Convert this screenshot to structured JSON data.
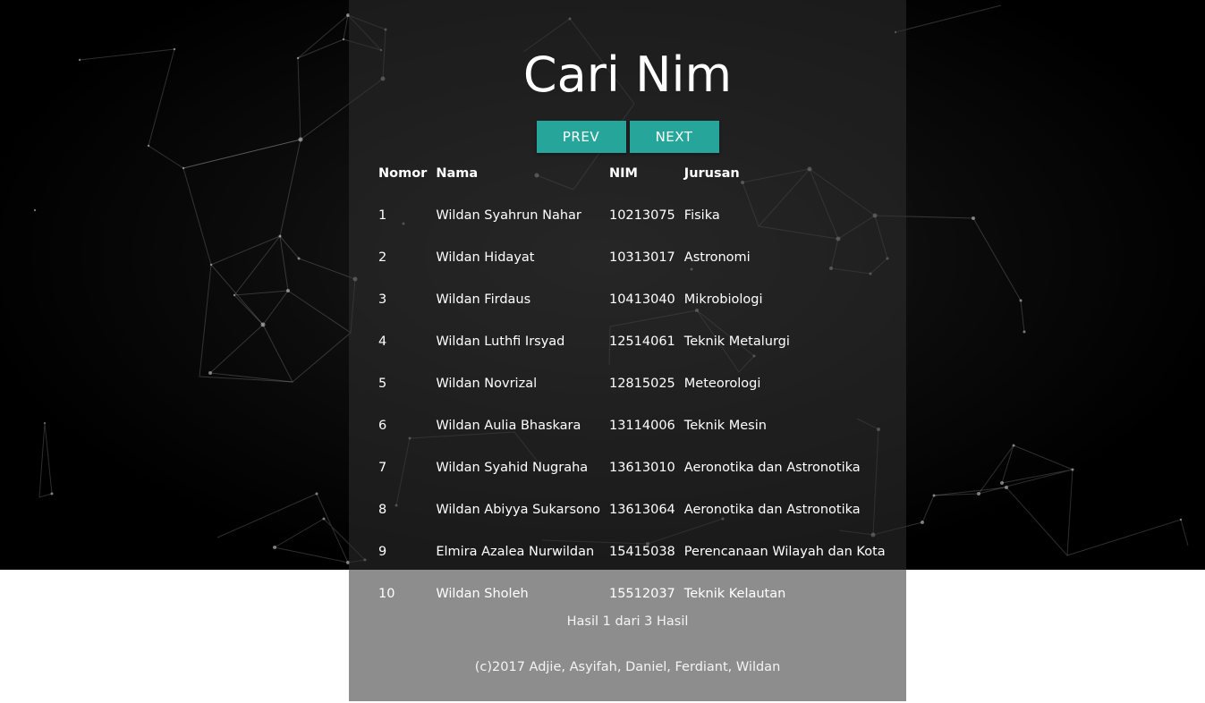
{
  "page": {
    "title": "Cari Nim"
  },
  "nav": {
    "prev_label": "PREV",
    "next_label": "NEXT"
  },
  "table": {
    "headers": [
      "Nomor",
      "Nama",
      "NIM",
      "Jurusan"
    ],
    "rows": [
      [
        "1",
        "Wildan Syahrun Nahar",
        "10213075",
        "Fisika"
      ],
      [
        "2",
        "Wildan Hidayat",
        "10313017",
        "Astronomi"
      ],
      [
        "3",
        "Wildan Firdaus",
        "10413040",
        "Mikrobiologi"
      ],
      [
        "4",
        "Wildan Luthfi Irsyad",
        "12514061",
        "Teknik Metalurgi"
      ],
      [
        "5",
        "Wildan Novrizal",
        "12815025",
        "Meteorologi"
      ],
      [
        "6",
        "Wildan Aulia Bhaskara",
        "13114006",
        "Teknik Mesin"
      ],
      [
        "7",
        "Wildan Syahid Nugraha",
        "13613010",
        "Aeronotika dan Astronotika"
      ],
      [
        "8",
        "Wildan Abiyya Sukarsono",
        "13613064",
        "Aeronotika dan Astronotika"
      ],
      [
        "9",
        "Elmira Azalea Nurwildan",
        "15415038",
        "Perencanaan Wilayah dan Kota"
      ],
      [
        "10",
        "Wildan Sholeh",
        "15512037",
        "Teknik Kelautan"
      ]
    ]
  },
  "footer": {
    "results": "Hasil 1 dari 3 Hasil",
    "copyright": "(c)2017 Adjie, Asyifah, Daniel, Ferdiant, Wildan"
  },
  "colors": {
    "button": "#26a69a",
    "background": "#000000",
    "panel": "#303030"
  }
}
